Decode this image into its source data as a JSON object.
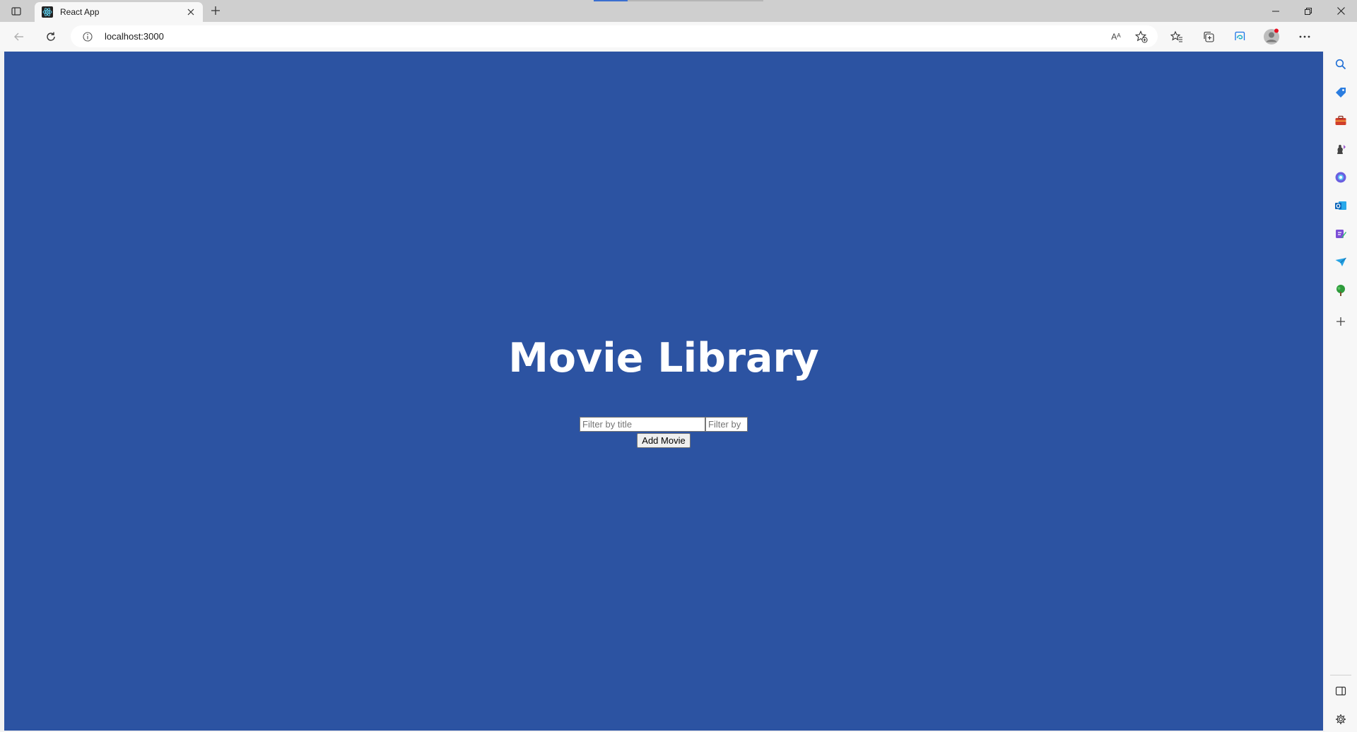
{
  "browser": {
    "tab": {
      "title": "React App"
    },
    "address": {
      "url": "localhost:3000"
    },
    "read_aloud_label": "Aᴬ",
    "icons": {
      "tab_actions": "tab-actions-icon",
      "favicon": "react-favicon-icon",
      "close_tab": "close-icon",
      "new_tab": "plus-icon",
      "back": "back-arrow-icon",
      "refresh": "refresh-icon",
      "site_info": "info-icon",
      "favorite_add": "star-plus-icon",
      "favorites": "favorites-icon",
      "collections": "collections-icon",
      "performance": "browser-essentials-icon",
      "profile": "profile-icon",
      "more": "more-icon",
      "copilot": "copilot-icon",
      "minimize": "minimize-icon",
      "restore": "restore-icon",
      "close_window": "close-window-icon"
    },
    "sidebar": [
      "search-icon",
      "shopping-tag-icon",
      "tools-icon",
      "games-icon",
      "office-icon",
      "outlook-icon",
      "designer-icon",
      "send-icon",
      "tree-icon",
      "add-icon",
      "split-pane-icon",
      "settings-icon"
    ]
  },
  "app": {
    "title": "Movie Library",
    "filter_title_placeholder": "Filter by title",
    "filter_second_placeholder": "Filter by",
    "add_button_label": "Add Movie"
  },
  "colors": {
    "page_background": "#2c53a2",
    "title_color": "#ffffff",
    "chrome_background": "#f7f7f7",
    "tabstrip_background": "#cfcfcf"
  }
}
